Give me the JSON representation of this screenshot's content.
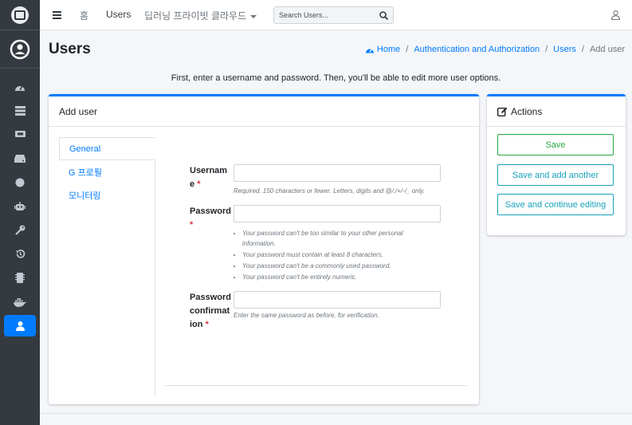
{
  "nav": {
    "home": "홈",
    "users": "Users",
    "cloud": "딥러닝 프라이빗 클라우드",
    "search_placeholder": "Search Users..."
  },
  "page": {
    "title": "Users",
    "breadcrumb": [
      "Home",
      "Authentication and Authorization",
      "Users",
      "Add user"
    ],
    "intro": "First, enter a username and password. Then, you'll be able to edit more user options."
  },
  "form": {
    "header": "Add user",
    "tabs": [
      "General",
      "G 프로필",
      "모니터링"
    ],
    "username_label": "Username",
    "username_help": "Required. 150 characters or fewer. Letters, digits and @/./+/-/_ only.",
    "password_label": "Password",
    "password_help": [
      "Your password can't be too similar to your other personal information.",
      "Your password must contain at least 8 characters.",
      "Your password can't be a commonly used password.",
      "Your password can't be entirely numeric."
    ],
    "confirm_label": "Password confirmation",
    "confirm_help": "Enter the same password as before, for verification.",
    "required_mark": "*"
  },
  "actions": {
    "header": "Actions",
    "save": "Save",
    "save_add": "Save and add another",
    "save_continue": "Save and continue editing"
  },
  "colors": {
    "primary": "#007bff",
    "success": "#28a745",
    "info": "#17a2b8",
    "sidebar": "#343a40"
  }
}
